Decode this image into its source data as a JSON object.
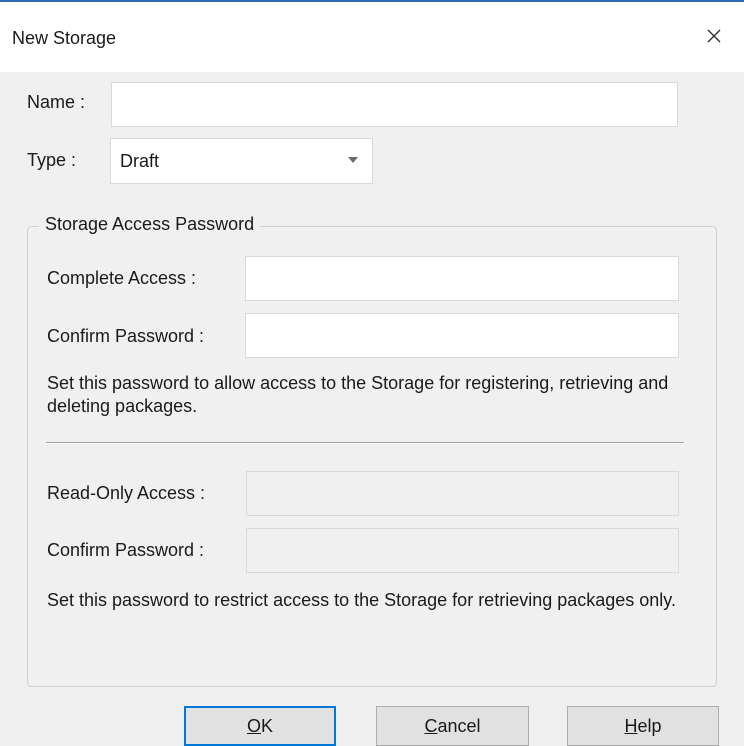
{
  "dialog": {
    "title": "New Storage",
    "close_glyph": "✕"
  },
  "form": {
    "name_label": "Name :",
    "name_value": "",
    "type_label": "Type :",
    "type_value": "Draft"
  },
  "group": {
    "legend": "Storage Access Password",
    "complete_access_label": "Complete Access :",
    "complete_access_value": "",
    "confirm_password_label_1": "Confirm Password :",
    "confirm_password_value_1": "",
    "complete_help": "Set this password to allow access to the Storage for registering, retrieving and deleting packages.",
    "readonly_access_label": "Read-Only Access :",
    "readonly_access_value": "",
    "confirm_password_label_2": "Confirm Password :",
    "confirm_password_value_2": "",
    "readonly_help": "Set this password to restrict access to the Storage for retrieving packages only."
  },
  "buttons": {
    "ok_mnemonic": "O",
    "ok_rest": "K",
    "cancel_mnemonic": "C",
    "cancel_rest": "ancel",
    "help_mnemonic": "H",
    "help_rest": "elp"
  },
  "colors": {
    "accent": "#0078d7",
    "window_border": "#2b6cb0",
    "background": "#f0f0f0"
  }
}
